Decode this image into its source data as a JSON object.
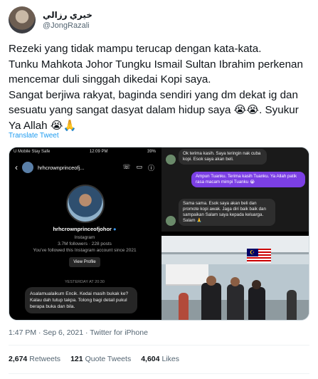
{
  "author": {
    "display_name": "خيري رزالي",
    "handle": "@JongRazali"
  },
  "tweet": {
    "text": "Rezeki yang tidak mampu terucap dengan kata-kata.\nTunku Mahkota Johor Tungku Ismail Sultan Ibrahim perkenan mencemar duli singgah dikedai Kopi saya.\nSangat berjiwa rakyat, baginda sendiri yang dm dekat ig dan sesuatu yang sangat dasyat dalam hidup saya 😭😭. Syukur Ya Allah 😭🙏",
    "translate_label": "Translate Tweet",
    "timestamp": "1:47 PM · Sep 6, 2021 · Twitter for iPhone"
  },
  "stats": {
    "retweets_count": "2,674",
    "retweets_label": "Retweets",
    "quotes_count": "121",
    "quotes_label": "Quote Tweets",
    "likes_count": "4,604",
    "likes_label": "Likes"
  },
  "media": {
    "ig_screen": {
      "status_carrier": "U Mobile Stay Safe",
      "status_time": "12:09 PM",
      "status_battery": "39%",
      "thread_title": "hrhcrownprinceofj...",
      "profile_name": "hrhcrownprinceofjohor",
      "profile_platform": "Instagram",
      "profile_stats": "3.7M followers · 228 posts",
      "profile_follow_note": "You've followed this Instagram account since 2021",
      "view_profile": "View Profile",
      "yesterday": "YESTERDAY AT 20:30",
      "dm_message": "Asalamualaikum Encik. Kedai masih bukak ke? Kalau dah tutup takpa. Tolong bagi detail pukul berapa buka dan bila."
    },
    "chat_screen": {
      "msg1": "Ok terima kasih. Saya teringin nak cuba kopi. Esok saya akan beli.",
      "msg2": "Ampun Tuanku. Terima kasih Tuanku. Ya Allah patik rasa macam mimpi Tuanku 😭",
      "msg3": "Sama sama. Esok saya akan beli dan promote kopi awak. Jaga diri baik baik dan sampaikan Salam saya kepada keluarga. Salam 🙏"
    }
  }
}
